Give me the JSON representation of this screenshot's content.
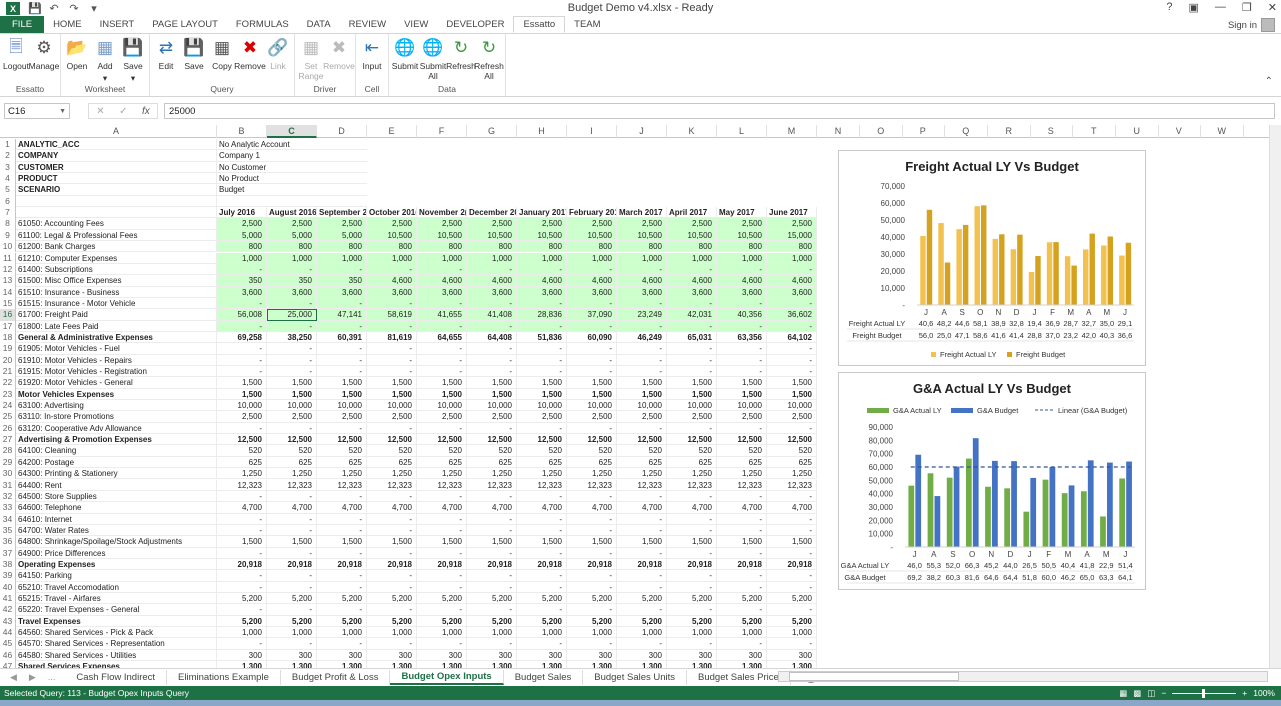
{
  "window": {
    "title": "Budget Demo v4.xlsx - Ready",
    "controls": [
      "?",
      "ribbon-display",
      "minimize",
      "restore",
      "close"
    ]
  },
  "ribbon_tabs": [
    "FILE",
    "HOME",
    "INSERT",
    "PAGE LAYOUT",
    "FORMULAS",
    "DATA",
    "REVIEW",
    "VIEW",
    "DEVELOPER",
    "Essatto",
    "TEAM"
  ],
  "active_tab": "Essatto",
  "signin": "Sign in",
  "ribbon_groups": [
    {
      "label": "Essatto",
      "buttons": [
        {
          "label": "Logout",
          "icon": "logout-icon",
          "enabled": true
        },
        {
          "label": "Manage",
          "icon": "gears-icon",
          "enabled": true
        }
      ]
    },
    {
      "label": "Worksheet",
      "buttons": [
        {
          "label": "Open",
          "icon": "folder-open-icon",
          "enabled": true
        },
        {
          "label": "Add",
          "icon": "add-sheet-icon",
          "enabled": true,
          "dropdown": true
        },
        {
          "label": "Save",
          "icon": "save-icon",
          "enabled": true,
          "dropdown": true
        }
      ]
    },
    {
      "label": "Query",
      "buttons": [
        {
          "label": "Edit",
          "icon": "edit-query-icon",
          "enabled": true
        },
        {
          "label": "Save",
          "icon": "save-icon",
          "enabled": true
        },
        {
          "label": "Copy",
          "icon": "copy-query-icon",
          "enabled": true
        },
        {
          "label": "Remove",
          "icon": "remove-query-icon",
          "enabled": true
        },
        {
          "label": "Link",
          "icon": "link-icon",
          "enabled": false
        }
      ]
    },
    {
      "label": "Driver",
      "buttons": [
        {
          "label": "Set Range",
          "icon": "set-range-icon",
          "enabled": false
        },
        {
          "label": "Remove",
          "icon": "remove-driver-icon",
          "enabled": false
        }
      ]
    },
    {
      "label": "Cell",
      "buttons": [
        {
          "label": "Input",
          "icon": "input-cell-icon",
          "enabled": true
        }
      ]
    },
    {
      "label": "Data",
      "buttons": [
        {
          "label": "Submit",
          "icon": "submit-icon",
          "enabled": true
        },
        {
          "label": "Submit All",
          "icon": "submit-all-icon",
          "enabled": true
        },
        {
          "label": "Refresh",
          "icon": "refresh-icon",
          "enabled": true
        },
        {
          "label": "Refresh All",
          "icon": "refresh-all-icon",
          "enabled": true
        }
      ]
    }
  ],
  "formula_bar": {
    "name_box": "C16",
    "value": "25000"
  },
  "columns": [
    "A",
    "B",
    "C",
    "D",
    "E",
    "F",
    "G",
    "H",
    "I",
    "J",
    "K",
    "L",
    "M",
    "N",
    "O",
    "P",
    "Q",
    "R",
    "S",
    "T",
    "U",
    "V",
    "W"
  ],
  "selected_column": "C",
  "selected_row": 16,
  "header_rows": [
    {
      "row": 1,
      "label": "ANALYTIC_ACC",
      "value": "No Analytic Account"
    },
    {
      "row": 2,
      "label": "COMPANY",
      "value": "Company 1"
    },
    {
      "row": 3,
      "label": "CUSTOMER",
      "value": "No Customer"
    },
    {
      "row": 4,
      "label": "PRODUCT",
      "value": "No Product"
    },
    {
      "row": 5,
      "label": "SCENARIO",
      "value": "Budget"
    },
    {
      "row": 6,
      "label": "",
      "value": ""
    }
  ],
  "months": [
    "July 2016",
    "August 2016",
    "September 2",
    "October 201(",
    "November 2(",
    "December 20",
    "January 2017",
    "February 201",
    "March 2017",
    "April 2017",
    "May 2017",
    "June 2017"
  ],
  "data_rows": [
    {
      "row": 8,
      "label": "61050: Accounting Fees",
      "green": true,
      "values": [
        "2,500",
        "2,500",
        "2,500",
        "2,500",
        "2,500",
        "2,500",
        "2,500",
        "2,500",
        "2,500",
        "2,500",
        "2,500",
        "2,500"
      ]
    },
    {
      "row": 9,
      "label": "61100: Legal & Professional Fees",
      "green": true,
      "values": [
        "5,000",
        "5,000",
        "5,000",
        "10,500",
        "10,500",
        "10,500",
        "10,500",
        "10,500",
        "10,500",
        "10,500",
        "10,500",
        "15,000"
      ]
    },
    {
      "row": 10,
      "label": "61200: Bank Charges",
      "green": true,
      "values": [
        "800",
        "800",
        "800",
        "800",
        "800",
        "800",
        "800",
        "800",
        "800",
        "800",
        "800",
        "800"
      ]
    },
    {
      "row": 11,
      "label": "61210: Computer Expenses",
      "green": true,
      "values": [
        "1,000",
        "1,000",
        "1,000",
        "1,000",
        "1,000",
        "1,000",
        "1,000",
        "1,000",
        "1,000",
        "1,000",
        "1,000",
        "1,000"
      ]
    },
    {
      "row": 12,
      "label": "61400: Subscriptions",
      "green": true,
      "values": [
        "-",
        "-",
        "-",
        "-",
        "-",
        "-",
        "-",
        "-",
        "-",
        "-",
        "-",
        "-"
      ]
    },
    {
      "row": 13,
      "label": "61500: Misc Office Expenses",
      "green": true,
      "values": [
        "350",
        "350",
        "350",
        "4,600",
        "4,600",
        "4,600",
        "4,600",
        "4,600",
        "4,600",
        "4,600",
        "4,600",
        "4,600"
      ]
    },
    {
      "row": 14,
      "label": "61510: Insurance - Business",
      "green": true,
      "values": [
        "3,600",
        "3,600",
        "3,600",
        "3,600",
        "3,600",
        "3,600",
        "3,600",
        "3,600",
        "3,600",
        "3,600",
        "3,600",
        "3,600"
      ]
    },
    {
      "row": 15,
      "label": "61515: Insurance - Motor Vehicle",
      "green": true,
      "values": [
        "-",
        "-",
        "-",
        "-",
        "-",
        "-",
        "-",
        "-",
        "-",
        "-",
        "-",
        "-"
      ]
    },
    {
      "row": 16,
      "label": "61700: Freight Paid",
      "green": true,
      "values": [
        "56,008",
        "25,000",
        "47,141",
        "58,619",
        "41,655",
        "41,408",
        "28,836",
        "37,090",
        "23,249",
        "42,031",
        "40,356",
        "36,602"
      ]
    },
    {
      "row": 17,
      "label": "61800: Late Fees Paid",
      "green": true,
      "values": [
        "-",
        "-",
        "-",
        "-",
        "-",
        "-",
        "-",
        "-",
        "-",
        "-",
        "-",
        "-"
      ]
    },
    {
      "row": 18,
      "label": "General & Administrative Expenses",
      "bold": true,
      "values": [
        "69,258",
        "38,250",
        "60,391",
        "81,619",
        "64,655",
        "64,408",
        "51,836",
        "60,090",
        "46,249",
        "65,031",
        "63,356",
        "64,102"
      ]
    },
    {
      "row": 19,
      "label": "61905: Motor Vehicles - Fuel",
      "values": [
        "-",
        "-",
        "-",
        "-",
        "-",
        "-",
        "-",
        "-",
        "-",
        "-",
        "-",
        "-"
      ]
    },
    {
      "row": 20,
      "label": "61910: Motor Vehicles - Repairs",
      "values": [
        "-",
        "-",
        "-",
        "-",
        "-",
        "-",
        "-",
        "-",
        "-",
        "-",
        "-",
        "-"
      ]
    },
    {
      "row": 21,
      "label": "61915: Motor Vehicles - Registration",
      "values": [
        "-",
        "-",
        "-",
        "-",
        "-",
        "-",
        "-",
        "-",
        "-",
        "-",
        "-",
        "-"
      ]
    },
    {
      "row": 22,
      "label": "61920: Motor Vehicles - General",
      "values": [
        "1,500",
        "1,500",
        "1,500",
        "1,500",
        "1,500",
        "1,500",
        "1,500",
        "1,500",
        "1,500",
        "1,500",
        "1,500",
        "1,500"
      ]
    },
    {
      "row": 23,
      "label": "Motor Vehicles Expenses",
      "bold": true,
      "values": [
        "1,500",
        "1,500",
        "1,500",
        "1,500",
        "1,500",
        "1,500",
        "1,500",
        "1,500",
        "1,500",
        "1,500",
        "1,500",
        "1,500"
      ]
    },
    {
      "row": 24,
      "label": "63100: Advertising",
      "values": [
        "10,000",
        "10,000",
        "10,000",
        "10,000",
        "10,000",
        "10,000",
        "10,000",
        "10,000",
        "10,000",
        "10,000",
        "10,000",
        "10,000"
      ]
    },
    {
      "row": 25,
      "label": "63110: In-store Promotions",
      "values": [
        "2,500",
        "2,500",
        "2,500",
        "2,500",
        "2,500",
        "2,500",
        "2,500",
        "2,500",
        "2,500",
        "2,500",
        "2,500",
        "2,500"
      ]
    },
    {
      "row": 26,
      "label": "63120: Cooperative Adv Allowance",
      "values": [
        "-",
        "-",
        "-",
        "-",
        "-",
        "-",
        "-",
        "-",
        "-",
        "-",
        "-",
        "-"
      ]
    },
    {
      "row": 27,
      "label": "Advertising & Promotion Expenses",
      "bold": true,
      "values": [
        "12,500",
        "12,500",
        "12,500",
        "12,500",
        "12,500",
        "12,500",
        "12,500",
        "12,500",
        "12,500",
        "12,500",
        "12,500",
        "12,500"
      ]
    },
    {
      "row": 28,
      "label": "64100: Cleaning",
      "values": [
        "520",
        "520",
        "520",
        "520",
        "520",
        "520",
        "520",
        "520",
        "520",
        "520",
        "520",
        "520"
      ]
    },
    {
      "row": 29,
      "label": "64200: Postage",
      "values": [
        "625",
        "625",
        "625",
        "625",
        "625",
        "625",
        "625",
        "625",
        "625",
        "625",
        "625",
        "625"
      ]
    },
    {
      "row": 30,
      "label": "64300: Printing & Stationery",
      "values": [
        "1,250",
        "1,250",
        "1,250",
        "1,250",
        "1,250",
        "1,250",
        "1,250",
        "1,250",
        "1,250",
        "1,250",
        "1,250",
        "1,250"
      ]
    },
    {
      "row": 31,
      "label": "64400: Rent",
      "values": [
        "12,323",
        "12,323",
        "12,323",
        "12,323",
        "12,323",
        "12,323",
        "12,323",
        "12,323",
        "12,323",
        "12,323",
        "12,323",
        "12,323"
      ]
    },
    {
      "row": 32,
      "label": "64500: Store Supplies",
      "values": [
        "-",
        "-",
        "-",
        "-",
        "-",
        "-",
        "-",
        "-",
        "-",
        "-",
        "-",
        "-"
      ]
    },
    {
      "row": 33,
      "label": "64600: Telephone",
      "values": [
        "4,700",
        "4,700",
        "4,700",
        "4,700",
        "4,700",
        "4,700",
        "4,700",
        "4,700",
        "4,700",
        "4,700",
        "4,700",
        "4,700"
      ]
    },
    {
      "row": 34,
      "label": "64610: Internet",
      "values": [
        "-",
        "-",
        "-",
        "-",
        "-",
        "-",
        "-",
        "-",
        "-",
        "-",
        "-",
        "-"
      ]
    },
    {
      "row": 35,
      "label": "64700: Water Rates",
      "values": [
        "-",
        "-",
        "-",
        "-",
        "-",
        "-",
        "-",
        "-",
        "-",
        "-",
        "-",
        "-"
      ]
    },
    {
      "row": 36,
      "label": "64800: Shrinkage/Spoilage/Stock Adjustments",
      "values": [
        "1,500",
        "1,500",
        "1,500",
        "1,500",
        "1,500",
        "1,500",
        "1,500",
        "1,500",
        "1,500",
        "1,500",
        "1,500",
        "1,500"
      ]
    },
    {
      "row": 37,
      "label": "64900: Price Differences",
      "values": [
        "-",
        "-",
        "-",
        "-",
        "-",
        "-",
        "-",
        "-",
        "-",
        "-",
        "-",
        "-"
      ]
    },
    {
      "row": 38,
      "label": "Operating Expenses",
      "bold": true,
      "values": [
        "20,918",
        "20,918",
        "20,918",
        "20,918",
        "20,918",
        "20,918",
        "20,918",
        "20,918",
        "20,918",
        "20,918",
        "20,918",
        "20,918"
      ]
    },
    {
      "row": 39,
      "label": "64150: Parking",
      "values": [
        "-",
        "-",
        "-",
        "-",
        "-",
        "-",
        "-",
        "-",
        "-",
        "-",
        "-",
        "-"
      ]
    },
    {
      "row": 40,
      "label": "65210: Travel Accomodation",
      "values": [
        "-",
        "-",
        "-",
        "-",
        "-",
        "-",
        "-",
        "-",
        "-",
        "-",
        "-",
        "-"
      ]
    },
    {
      "row": 41,
      "label": "65215: Travel - Airfares",
      "values": [
        "5,200",
        "5,200",
        "5,200",
        "5,200",
        "5,200",
        "5,200",
        "5,200",
        "5,200",
        "5,200",
        "5,200",
        "5,200",
        "5,200"
      ]
    },
    {
      "row": 42,
      "label": "65220: Travel Expenses - General",
      "values": [
        "-",
        "-",
        "-",
        "-",
        "-",
        "-",
        "-",
        "-",
        "-",
        "-",
        "-",
        "-"
      ]
    },
    {
      "row": 43,
      "label": "Travel Expenses",
      "bold": true,
      "values": [
        "5,200",
        "5,200",
        "5,200",
        "5,200",
        "5,200",
        "5,200",
        "5,200",
        "5,200",
        "5,200",
        "5,200",
        "5,200",
        "5,200"
      ]
    },
    {
      "row": 44,
      "label": "64560: Shared Services - Pick & Pack",
      "values": [
        "1,000",
        "1,000",
        "1,000",
        "1,000",
        "1,000",
        "1,000",
        "1,000",
        "1,000",
        "1,000",
        "1,000",
        "1,000",
        "1,000"
      ]
    },
    {
      "row": 45,
      "label": "64570: Shared Services - Representation",
      "values": [
        "-",
        "-",
        "-",
        "-",
        "-",
        "-",
        "-",
        "-",
        "-",
        "-",
        "-",
        "-"
      ]
    },
    {
      "row": 46,
      "label": "64580: Shared Services - Utilities",
      "values": [
        "300",
        "300",
        "300",
        "300",
        "300",
        "300",
        "300",
        "300",
        "300",
        "300",
        "300",
        "300"
      ]
    },
    {
      "row": 47,
      "label": "Shared Services Expenses",
      "bold": true,
      "values": [
        "1,300",
        "1,300",
        "1,300",
        "1,300",
        "1,300",
        "1,300",
        "1,300",
        "1,300",
        "1,300",
        "1,300",
        "1,300",
        "1,300"
      ]
    }
  ],
  "chart_data": [
    {
      "type": "bar",
      "title": "Freight Actual LY Vs Budget",
      "categories": [
        "J",
        "A",
        "S",
        "O",
        "N",
        "D",
        "J",
        "F",
        "M",
        "A",
        "M",
        "J"
      ],
      "ylim": [
        0,
        70000
      ],
      "yticks": [
        "-",
        "10,000",
        "20,000",
        "30,000",
        "40,000",
        "50,000",
        "60,000",
        "70,000"
      ],
      "legend": "bottom",
      "series": [
        {
          "name": "Freight Actual LY",
          "color": "#f2c14e",
          "values": [
            40600,
            48200,
            44600,
            58100,
            38900,
            32800,
            19400,
            36900,
            28700,
            32700,
            35000,
            29100
          ],
          "table_labels": [
            "40,6",
            "48,2",
            "44,6",
            "58,1",
            "38,9",
            "32,8",
            "19,4",
            "36,9",
            "28,7",
            "32,7",
            "35,0",
            "29,1"
          ]
        },
        {
          "name": "Freight Budget",
          "color": "#d4a21f",
          "values": [
            56000,
            25000,
            47100,
            58600,
            41600,
            41400,
            28800,
            37000,
            23200,
            42000,
            40300,
            36600
          ],
          "table_labels": [
            "56,0",
            "25,0",
            "47,1",
            "58,6",
            "41,6",
            "41,4",
            "28,8",
            "37,0",
            "23,2",
            "42,0",
            "40,3",
            "36,6"
          ]
        }
      ]
    },
    {
      "type": "bar",
      "title": "G&A Actual LY Vs Budget",
      "categories": [
        "J",
        "A",
        "S",
        "O",
        "N",
        "D",
        "J",
        "F",
        "M",
        "A",
        "M",
        "J"
      ],
      "ylim": [
        0,
        90000
      ],
      "yticks": [
        "-",
        "10,000",
        "20,000",
        "30,000",
        "40,000",
        "50,000",
        "60,000",
        "70,000",
        "80,000",
        "90,000"
      ],
      "legend": "top",
      "series": [
        {
          "name": "G&A Actual LY",
          "color": "#70ad47",
          "values": [
            46000,
            55300,
            52000,
            66300,
            45200,
            44000,
            26500,
            50500,
            40400,
            41800,
            22900,
            51400
          ],
          "table_labels": [
            "46,0",
            "55,3",
            "52,0",
            "66,3",
            "45,2",
            "44,0",
            "26,5",
            "50,5",
            "40,4",
            "41,8",
            "22,9",
            "51,4"
          ]
        },
        {
          "name": "G&A Budget",
          "color": "#4472c4",
          "values": [
            69200,
            38200,
            60300,
            81600,
            64600,
            64400,
            51800,
            60000,
            46200,
            65000,
            63300,
            64100
          ],
          "table_labels": [
            "69,2",
            "38,2",
            "60,3",
            "81,6",
            "64,6",
            "64,4",
            "51,8",
            "60,0",
            "46,2",
            "65,0",
            "63,3",
            "64,1"
          ]
        }
      ],
      "trendline": {
        "name": "Linear (G&A Budget)",
        "color": "#2f5597",
        "value": 60000,
        "style": "dashed"
      }
    }
  ],
  "sheet_tabs": [
    "Cash Flow Indirect",
    "Eliminations Example",
    "Budget Profit & Loss",
    "Budget Opex Inputs",
    "Budget Sales",
    "Budget Sales Units",
    "Budget Sales Price"
  ],
  "active_sheet": "Budget Opex Inputs",
  "status": {
    "text": "Selected Query: 113 - Budget Opex Inputs Query",
    "zoom": "100%"
  }
}
